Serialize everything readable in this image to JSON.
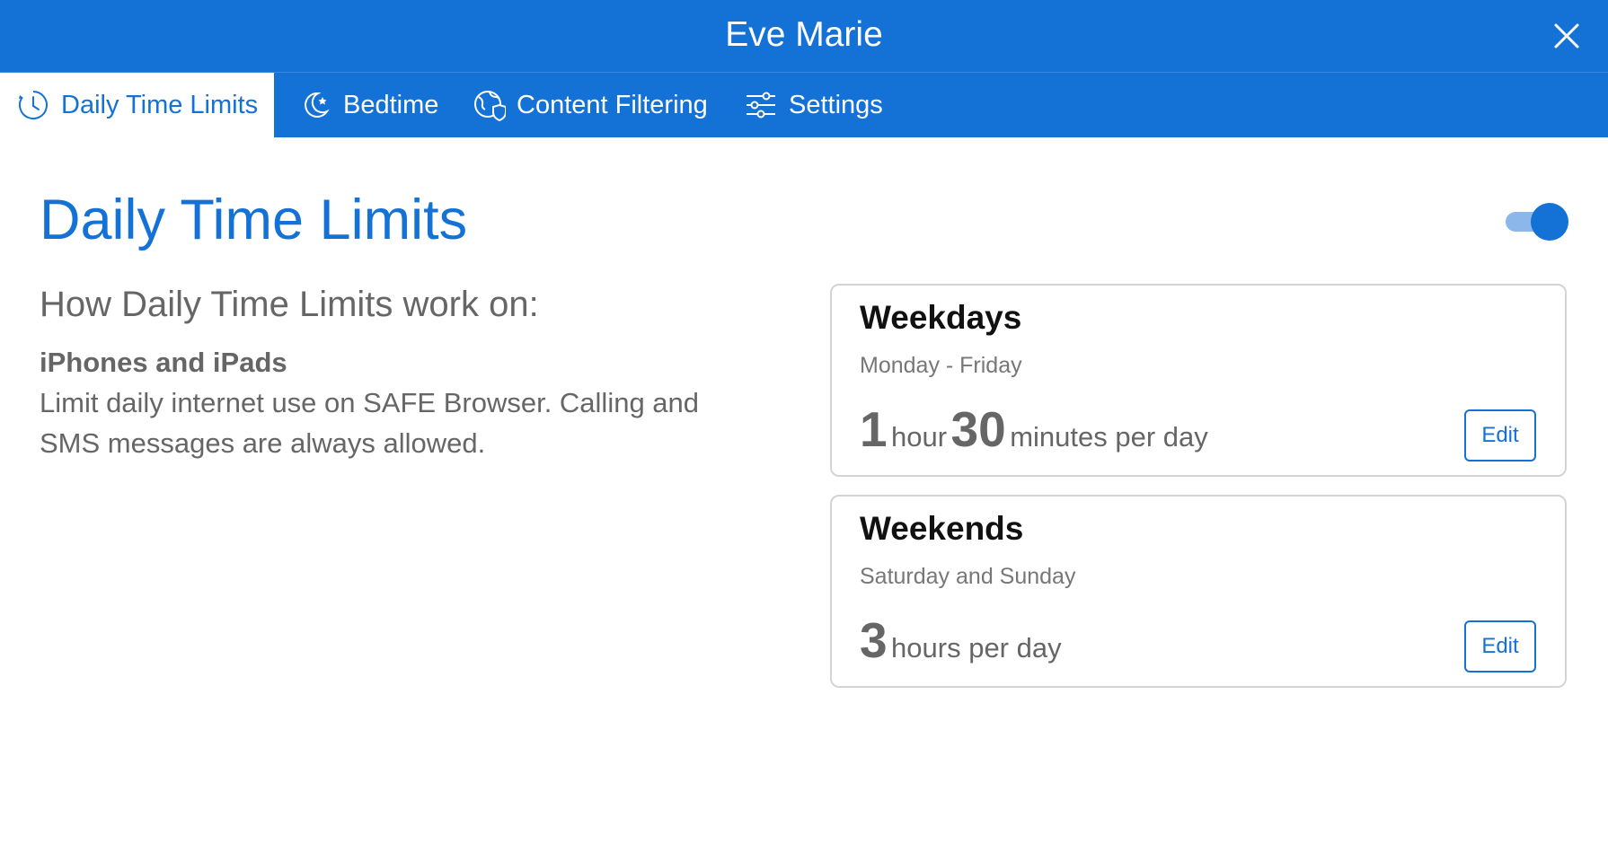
{
  "window": {
    "title": "Eve Marie",
    "close_icon": "close-icon"
  },
  "tabs": [
    {
      "label": "Daily Time Limits",
      "icon": "clock-icon",
      "active": true
    },
    {
      "label": "Bedtime",
      "icon": "moon-star-icon",
      "active": false
    },
    {
      "label": "Content Filtering",
      "icon": "globe-shield-icon",
      "active": false
    },
    {
      "label": "Settings",
      "icon": "sliders-icon",
      "active": false
    }
  ],
  "main": {
    "title": "Daily Time Limits",
    "enabled": true,
    "how_heading": "How Daily Time Limits work on:",
    "device_title": "iPhones and iPads",
    "device_description": "Limit daily internet use on SAFE Browser. Calling and SMS messages are always allowed."
  },
  "schedules": [
    {
      "title": "Weekdays",
      "subtitle": "Monday - Friday",
      "hours": "1",
      "hours_unit": "hour",
      "minutes": "30",
      "minutes_unit": "minutes per day",
      "edit_label": "Edit"
    },
    {
      "title": "Weekends",
      "subtitle": "Saturday and Sunday",
      "hours": "3",
      "hours_unit": "hours per day",
      "edit_label": "Edit"
    }
  ],
  "colors": {
    "brand": "#1471d6",
    "toggle_track": "#8cb7ea",
    "text_gray": "#666666"
  }
}
